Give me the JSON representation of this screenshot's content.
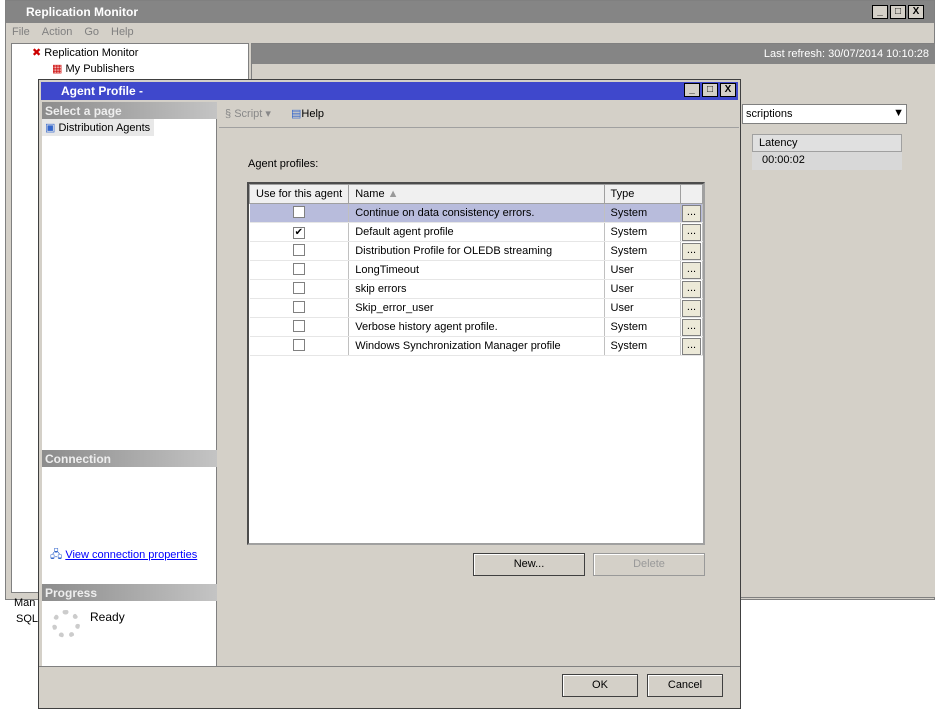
{
  "main_window": {
    "title": "Replication Monitor",
    "menu": [
      "File",
      "Action",
      "Go",
      "Help"
    ],
    "tree": [
      "Replication Monitor",
      "My Publishers"
    ],
    "last_refresh": "Last refresh: 30/07/2014 10:10:28",
    "dropdown_value": "scriptions",
    "grid_header": "Latency",
    "grid_value": "00:00:02",
    "bottom_items": [
      "Man",
      "SQL"
    ]
  },
  "dialog": {
    "title": "Agent Profile -",
    "select_page": "Select a page",
    "pages": [
      "Distribution Agents"
    ],
    "toolbar": {
      "script": "Script",
      "help": "Help"
    },
    "connection": "Connection",
    "view_connection": "View connection properties",
    "progress": "Progress",
    "progress_status": "Ready",
    "profiles_label": "Agent profiles:",
    "columns": [
      "Use for this agent",
      "Name",
      "Type"
    ],
    "rows": [
      {
        "checked": false,
        "name": "Continue on data consistency errors.",
        "type": "System",
        "selected": true
      },
      {
        "checked": true,
        "name": "Default agent profile",
        "type": "System"
      },
      {
        "checked": false,
        "name": "Distribution Profile for OLEDB streaming",
        "type": "System"
      },
      {
        "checked": false,
        "name": "LongTimeout",
        "type": "User"
      },
      {
        "checked": false,
        "name": "skip errors",
        "type": "User"
      },
      {
        "checked": false,
        "name": "Skip_error_user",
        "type": "User"
      },
      {
        "checked": false,
        "name": "Verbose history agent profile.",
        "type": "System"
      },
      {
        "checked": false,
        "name": "Windows Synchronization Manager profile",
        "type": "System"
      }
    ],
    "ellipsis": "...",
    "new": "New...",
    "delete": "Delete",
    "ok": "OK",
    "cancel": "Cancel"
  }
}
